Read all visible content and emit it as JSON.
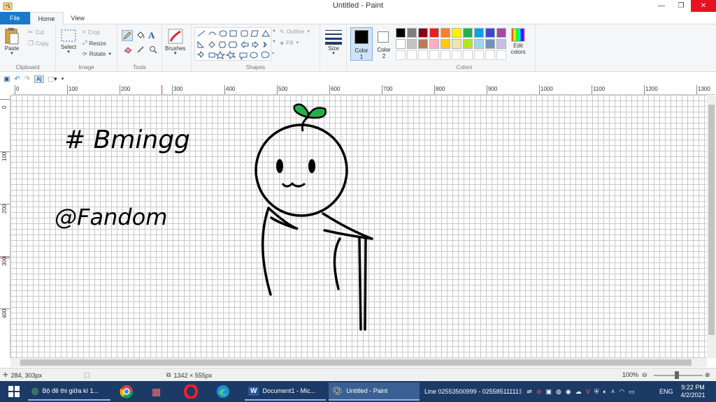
{
  "window": {
    "title": "Untitled - Paint",
    "minimize": "—",
    "restore": "❐",
    "close": "✕"
  },
  "tabs": {
    "file": "File",
    "home": "Home",
    "view": "View"
  },
  "ribbon": {
    "clipboard": {
      "label": "Clipboard",
      "paste": "Paste",
      "cut": "Cut",
      "copy": "Copy"
    },
    "image": {
      "label": "Image",
      "select": "Select",
      "crop": "Crop",
      "resize": "Resize",
      "rotate": "Rotate"
    },
    "tools": {
      "label": "Tools"
    },
    "brushes": {
      "label": "Brushes"
    },
    "shapes": {
      "label": "Shapes",
      "outline": "Outline",
      "fill": "Fill"
    },
    "size": {
      "label": "Size"
    },
    "color1": {
      "label": "Color",
      "num": "1",
      "value": "#000000"
    },
    "color2": {
      "label": "Color",
      "num": "2",
      "value": "#ffffff"
    },
    "colors": {
      "label": "Colors",
      "edit": "Edit",
      "edit2": "colors"
    },
    "palette_row1": [
      "#000000",
      "#7f7f7f",
      "#880015",
      "#ed1c24",
      "#ff7f27",
      "#fff200",
      "#22b14c",
      "#00a2e8",
      "#3f48cc",
      "#a349a4"
    ],
    "palette_row2": [
      "#ffffff",
      "#c3c3c3",
      "#b97a57",
      "#ffaec9",
      "#ffc90e",
      "#efe4b0",
      "#b5e61d",
      "#99d9ea",
      "#7092be",
      "#c8bfe7"
    ]
  },
  "ruler": {
    "h": [
      "0",
      "100",
      "200",
      "300",
      "400",
      "500",
      "600",
      "700",
      "800",
      "900",
      "1000",
      "1100",
      "1200",
      "1300"
    ],
    "v": [
      "0",
      "100",
      "200",
      "300",
      "400"
    ]
  },
  "drawing": {
    "line1": "# Bmingg",
    "line2": "@Fandom",
    "leaf_color": "#22b14c"
  },
  "status": {
    "cursor": "284, 303px",
    "size": "1342 × 555px",
    "zoom": "100%"
  },
  "taskbar": {
    "t1": "Bộ đề thi giữa kì 1...",
    "t2": "Document1 - Mic...",
    "t3": "Untitled - Paint",
    "phone": "Line 02553500999 - 02558511111",
    "lang": "ENG",
    "time": "9:22 PM",
    "date": "4/2/2021"
  }
}
